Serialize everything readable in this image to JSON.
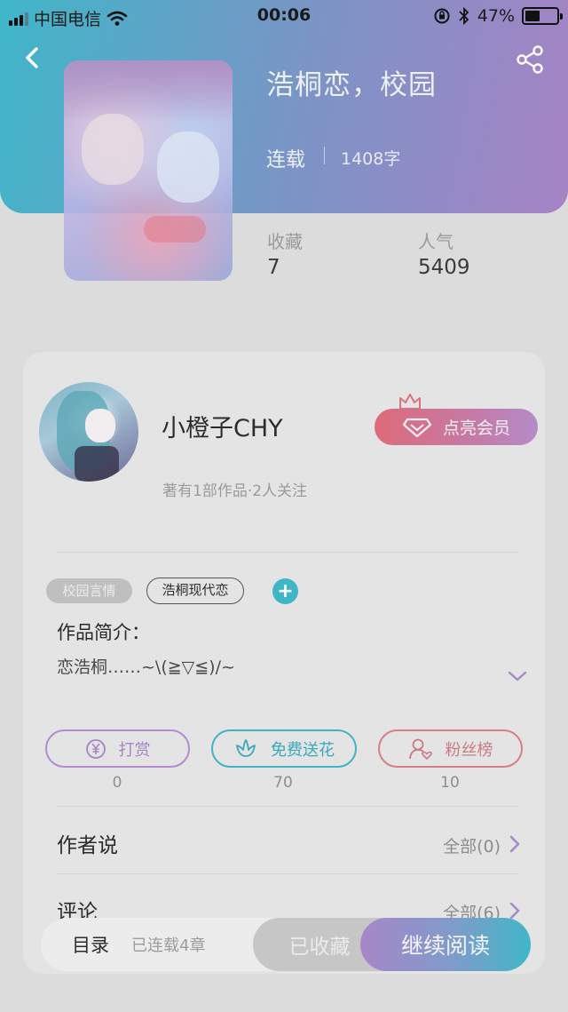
{
  "status_bar": {
    "carrier": "中国电信",
    "time": "00:06",
    "battery_percent": "47%",
    "battery_level": 0.47,
    "icons": [
      "signal-icon",
      "wifi-icon",
      "rotation-lock-icon",
      "bluetooth-icon",
      "battery-icon"
    ]
  },
  "book": {
    "title": "浩桐恋，校园",
    "status": "连载",
    "word_count": "1408字",
    "stats": [
      {
        "label": "收藏",
        "value": "7"
      },
      {
        "label": "人气",
        "value": "5409"
      }
    ]
  },
  "author": {
    "name": "小橙子CHY",
    "meta": "著有1部作品·2人关注",
    "vip_button_label": "点亮会员"
  },
  "tags": {
    "items": [
      "校园言情",
      "浩桐现代恋"
    ],
    "add_symbol": "+"
  },
  "intro": {
    "title": "作品简介：",
    "text": "恋浩桐……~\\(≧▽≦)/~"
  },
  "actions": [
    {
      "label": "打赏",
      "count": "0",
      "icon": "yen-icon"
    },
    {
      "label": "免费送花",
      "count": "70",
      "icon": "flower-icon"
    },
    {
      "label": "粉丝榜",
      "count": "10",
      "icon": "fan-user-icon"
    }
  ],
  "sections": {
    "author_says": {
      "title": "作者说",
      "more": "全部(0)"
    },
    "comments": {
      "title": "评论",
      "more": "全部(6)"
    }
  },
  "bottom_bar": {
    "catalog": "目录",
    "chapter_info": "已连载4章",
    "collected": "已收藏",
    "continue_reading": "继续阅读"
  },
  "colors": {
    "hero_gradient_start": "#3fb6c9",
    "hero_gradient_end": "#a683c4",
    "accent_teal": "#3fb5c5",
    "accent_purple": "#a884c3",
    "accent_red": "#d67f86"
  }
}
